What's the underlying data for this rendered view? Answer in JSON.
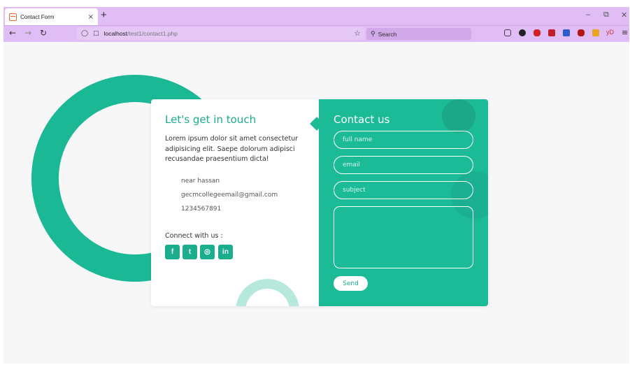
{
  "browser": {
    "tab_title": "Contact Form",
    "tab_close": "×",
    "new_tab": "+",
    "url_host": "localhost",
    "url_path": "/test1/contact1.php",
    "search_placeholder": "Search",
    "ext_label": "yD",
    "colors": {
      "chrome": "#e0bdf4",
      "accent": "#1cbb98"
    }
  },
  "page": {
    "left": {
      "title": "Let's get in touch",
      "text": "Lorem ipsum dolor sit amet consectetur adipisicing elit. Saepe dolorum adipisci recusandae praesentium dicta!",
      "name": "near hassan",
      "email": "gecmcollegeemail@gmail.com",
      "phone": "1234567891",
      "connect": "Connect with us :",
      "social": [
        {
          "label": "f",
          "icon": "facebook-icon"
        },
        {
          "label": "t",
          "icon": "twitter-icon"
        },
        {
          "label": "◎",
          "icon": "instagram-icon"
        },
        {
          "label": "in",
          "icon": "linkedin-icon"
        }
      ]
    },
    "right": {
      "title": "Contact us",
      "fields": {
        "full_name": "full name",
        "email": "email",
        "subject": "subject"
      },
      "send": "Send"
    }
  }
}
